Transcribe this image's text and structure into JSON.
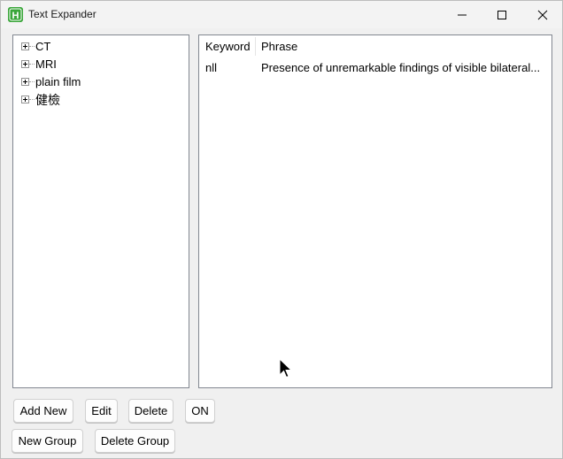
{
  "window": {
    "title": "Text Expander",
    "app_icon_letter": "H"
  },
  "tree": {
    "items": [
      {
        "label": "CT",
        "icon": "plus-expander-icon"
      },
      {
        "label": "MRI",
        "icon": "plus-expander-icon"
      },
      {
        "label": "plain film",
        "icon": "plus-expander-icon"
      },
      {
        "label": "健檢",
        "icon": "plus-expander-icon"
      }
    ]
  },
  "list": {
    "columns": [
      "Keyword",
      "Phrase"
    ],
    "rows": [
      {
        "keyword": "nll",
        "phrase": "Presence of unremarkable findings of visible bilateral..."
      }
    ]
  },
  "buttons": {
    "add_new": "Add New",
    "edit": "Edit",
    "delete": "Delete",
    "toggle": "ON",
    "new_group": "New Group",
    "delete_group": "Delete Group"
  },
  "colors": {
    "app_icon": "#3aa63a",
    "border": "#828790",
    "background": "#f0f0f0"
  }
}
